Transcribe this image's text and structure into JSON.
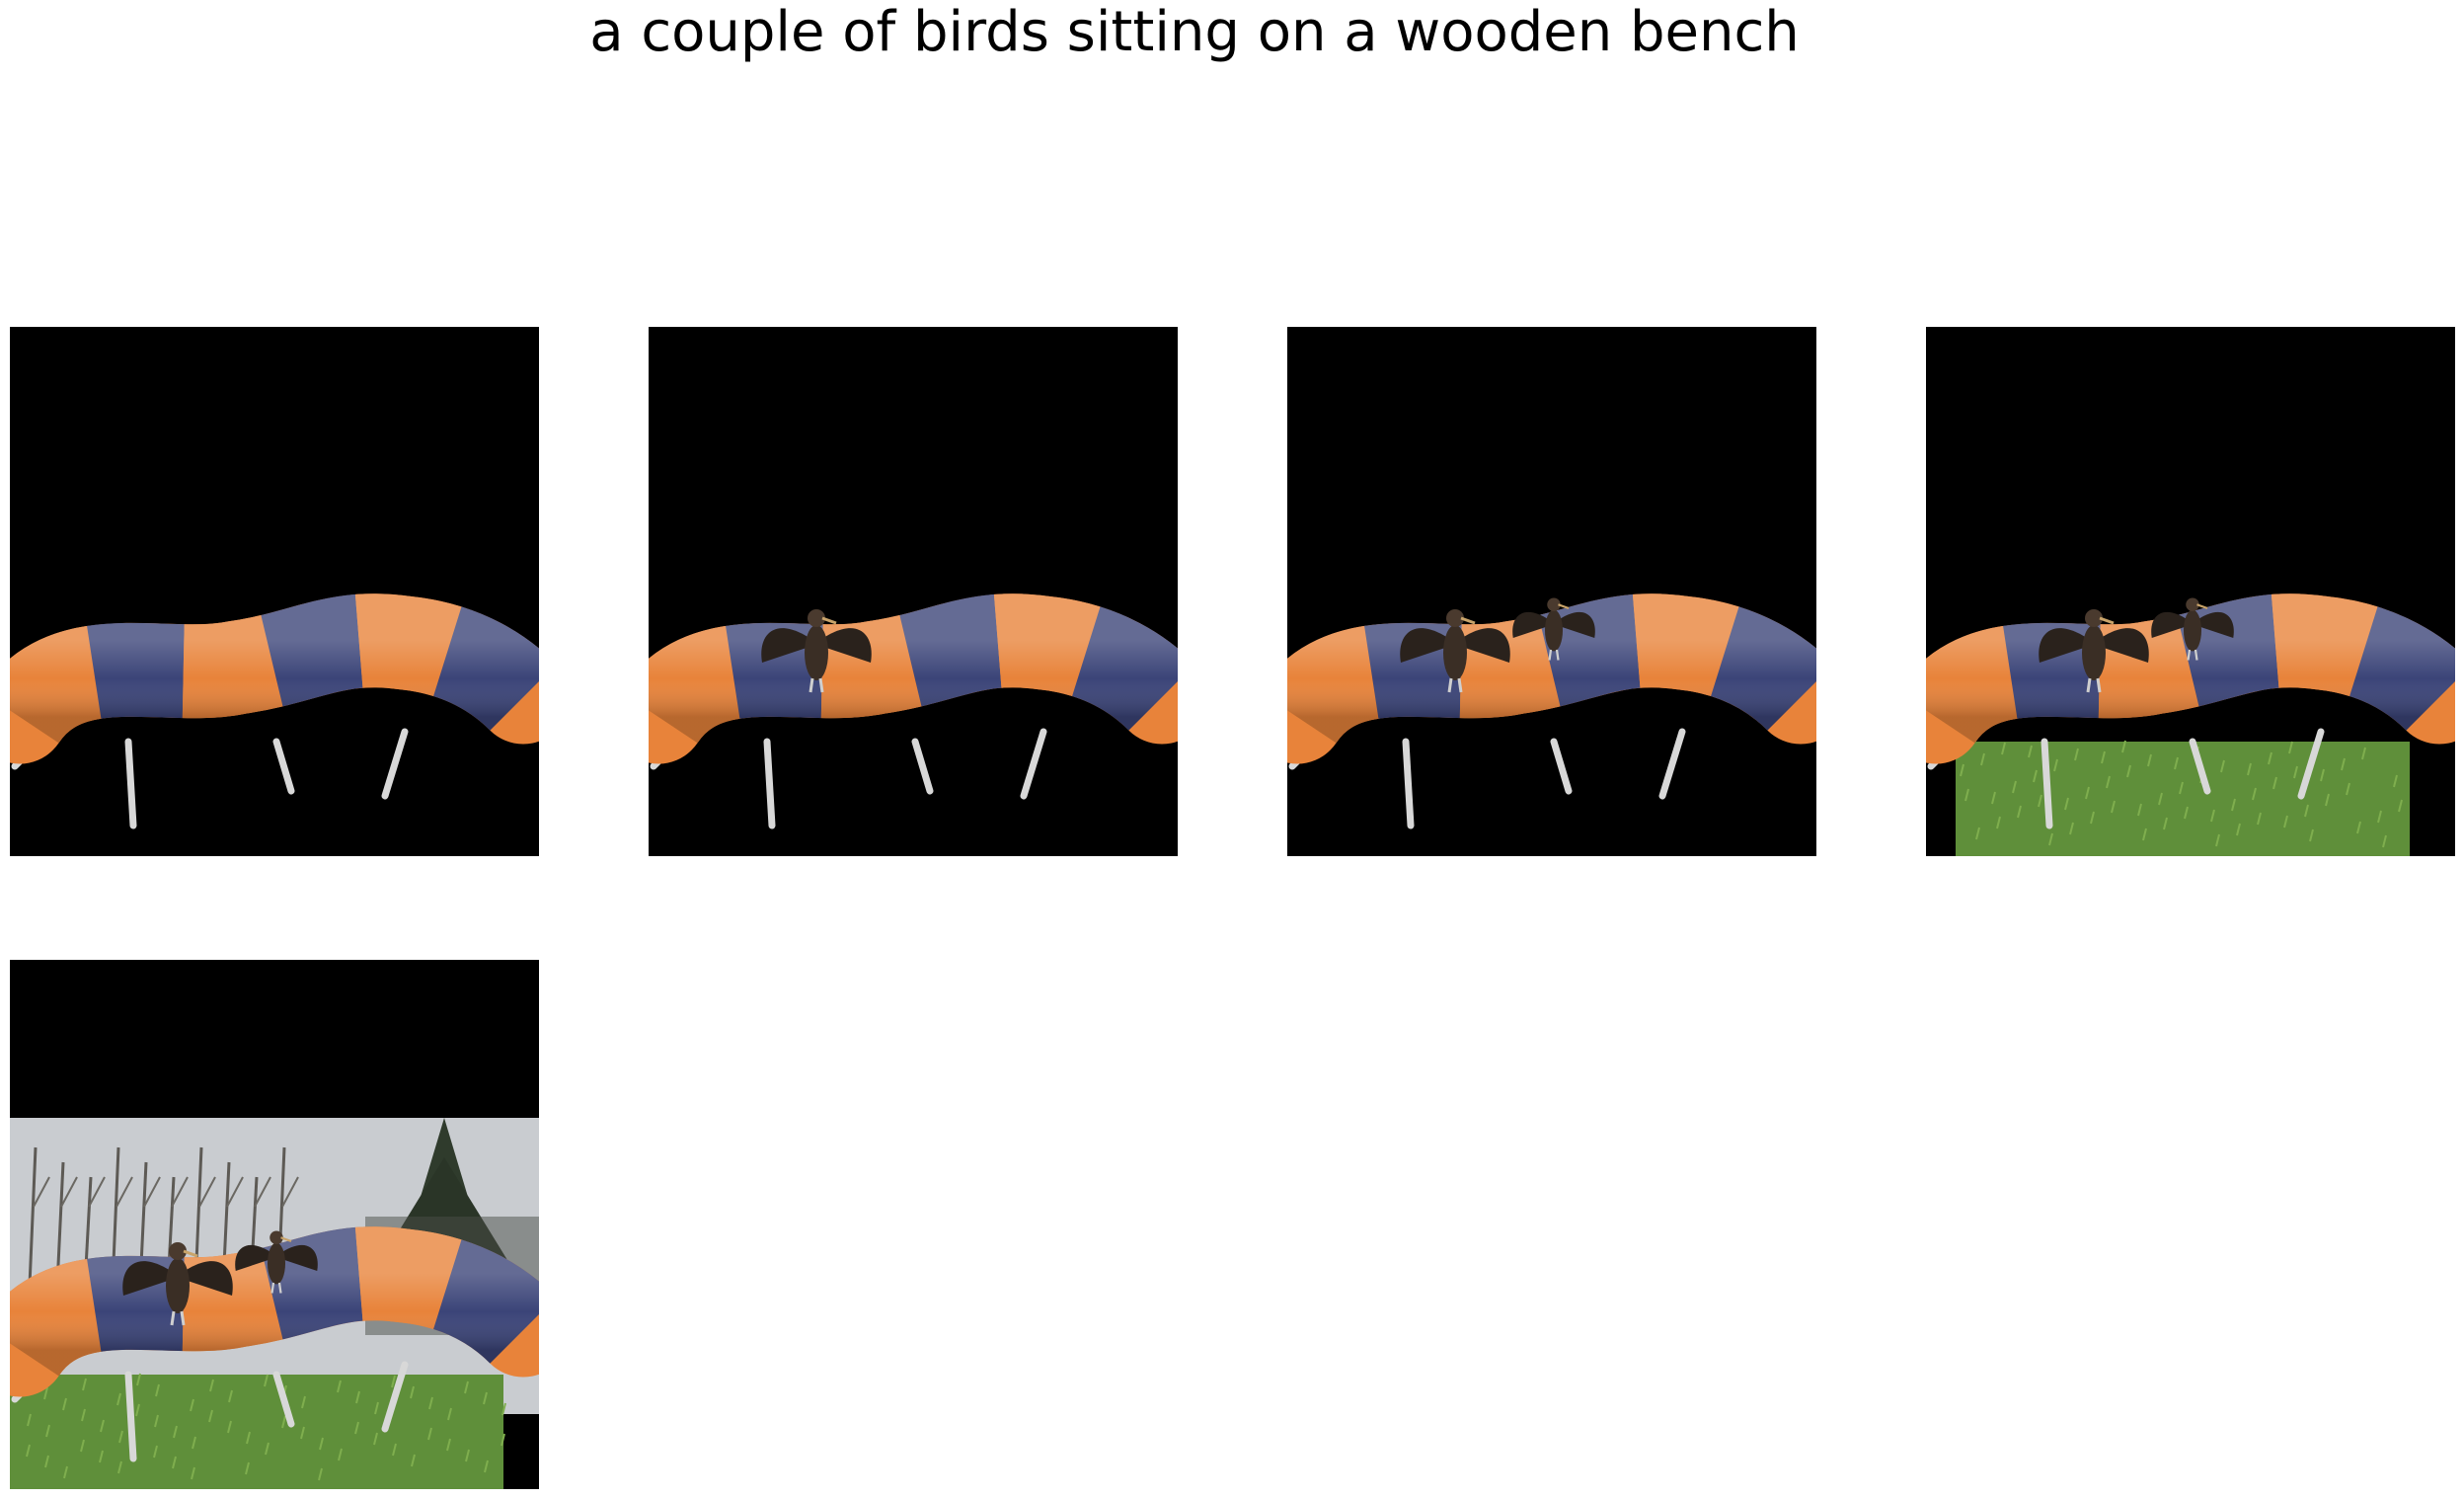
{
  "caption": "a couple of birds sitting on a wooden bench",
  "panels": [
    {
      "step": 1,
      "birds": 0,
      "grass": false,
      "background": false
    },
    {
      "step": 2,
      "birds": 1,
      "grass": false,
      "background": false
    },
    {
      "step": 3,
      "birds": 2,
      "grass": false,
      "background": false
    },
    {
      "step": 4,
      "birds": 2,
      "grass": true,
      "background": false
    },
    {
      "step": 5,
      "birds": 2,
      "grass": true,
      "background": true
    }
  ],
  "colors": {
    "orange": "#e8833a",
    "navy": "#3b4478",
    "black": "#000000",
    "grass": "#5f8f3a",
    "sky": "#c9ccd0"
  }
}
